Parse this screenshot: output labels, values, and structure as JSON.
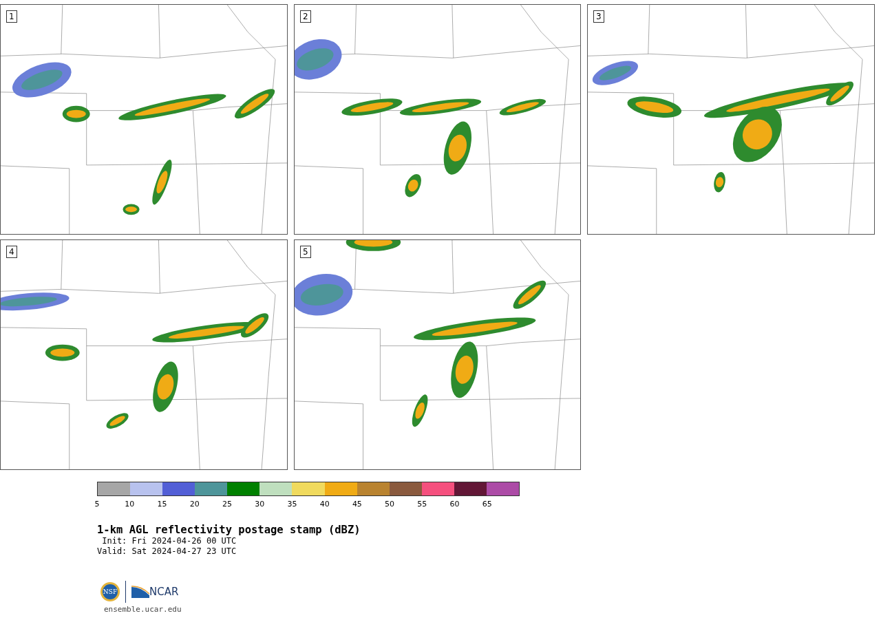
{
  "panels": [
    {
      "label": "1"
    },
    {
      "label": "2"
    },
    {
      "label": "3"
    },
    {
      "label": "4"
    },
    {
      "label": "5"
    }
  ],
  "colorbar": {
    "bins": [
      {
        "color": "#a6a6a6"
      },
      {
        "color": "#b8c2ee"
      },
      {
        "color": "#525fd6"
      },
      {
        "color": "#4e959a"
      },
      {
        "color": "#008000"
      },
      {
        "color": "#bfdfbe"
      },
      {
        "color": "#f0da5e"
      },
      {
        "color": "#f0ab15"
      },
      {
        "color": "#b98330"
      },
      {
        "color": "#8a5a3e"
      },
      {
        "color": "#f5507e"
      },
      {
        "color": "#621736"
      },
      {
        "color": "#ac4ba6"
      }
    ],
    "ticks": [
      "5",
      "10",
      "15",
      "20",
      "25",
      "30",
      "35",
      "40",
      "45",
      "50",
      "55",
      "60",
      "65"
    ]
  },
  "title": "1-km AGL reflectivity postage stamp (dBZ)",
  "init": " Init: Fri 2024-04-26 00 UTC",
  "valid": "Valid: Sat 2024-04-27 23 UTC",
  "logos": {
    "left": "NSF",
    "right": "NCAR"
  },
  "footer": "ensemble.ucar.edu"
}
